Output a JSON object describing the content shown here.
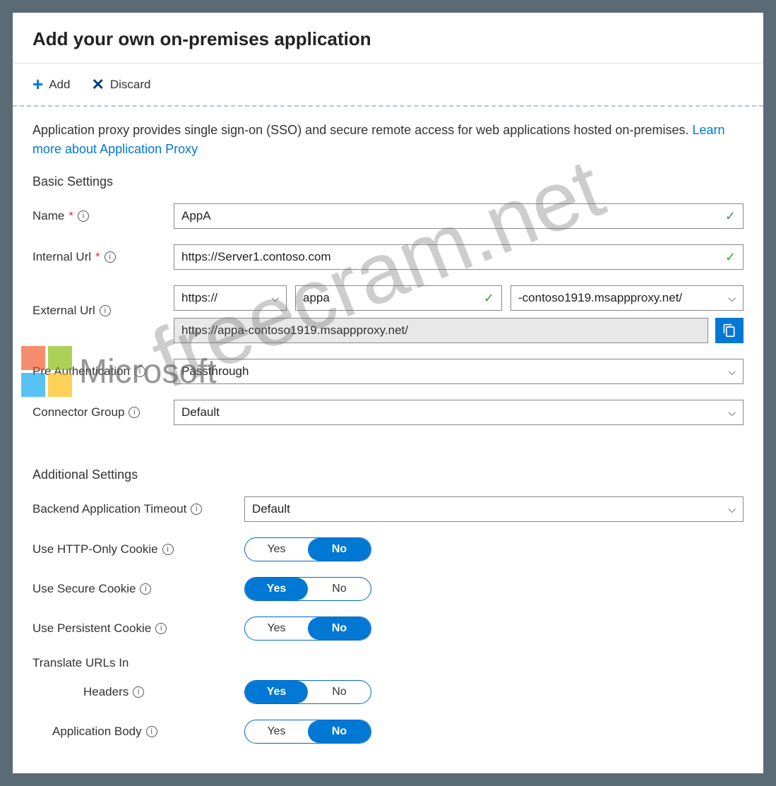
{
  "header": {
    "title": "Add your own on-premises application"
  },
  "toolbar": {
    "add": "Add",
    "discard": "Discard"
  },
  "intro": {
    "text": "Application proxy provides single sign-on (SSO) and secure remote access for web applications hosted on-premises. ",
    "link": "Learn more about Application Proxy"
  },
  "sections": {
    "basic": "Basic Settings",
    "additional": "Additional Settings",
    "translate": "Translate URLs In"
  },
  "labels": {
    "name": "Name",
    "internal_url": "Internal Url",
    "external_url": "External Url",
    "pre_auth": "Pre Authentication",
    "connector_group": "Connector Group",
    "backend_timeout": "Backend Application Timeout",
    "http_only": "Use HTTP-Only Cookie",
    "secure_cookie": "Use Secure Cookie",
    "persistent_cookie": "Use Persistent Cookie",
    "headers": "Headers",
    "application_body": "Application Body"
  },
  "values": {
    "name": "AppA",
    "internal_url": "https://Server1.contoso.com",
    "ext_scheme": "https://",
    "ext_sub": "appa",
    "ext_domain": "-contoso1919.msappproxy.net/",
    "ext_full": "https://appa-contoso1919.msappproxy.net/",
    "pre_auth": "Passthrough",
    "connector_group": "Default",
    "backend_timeout": "Default"
  },
  "toggle": {
    "yes": "Yes",
    "no": "No"
  },
  "toggle_states": {
    "http_only": "No",
    "secure_cookie": "Yes",
    "persistent_cookie": "No",
    "headers": "Yes",
    "application_body": "No"
  },
  "watermarks": {
    "ms": "Microsoft",
    "fc": "freecram.net"
  }
}
